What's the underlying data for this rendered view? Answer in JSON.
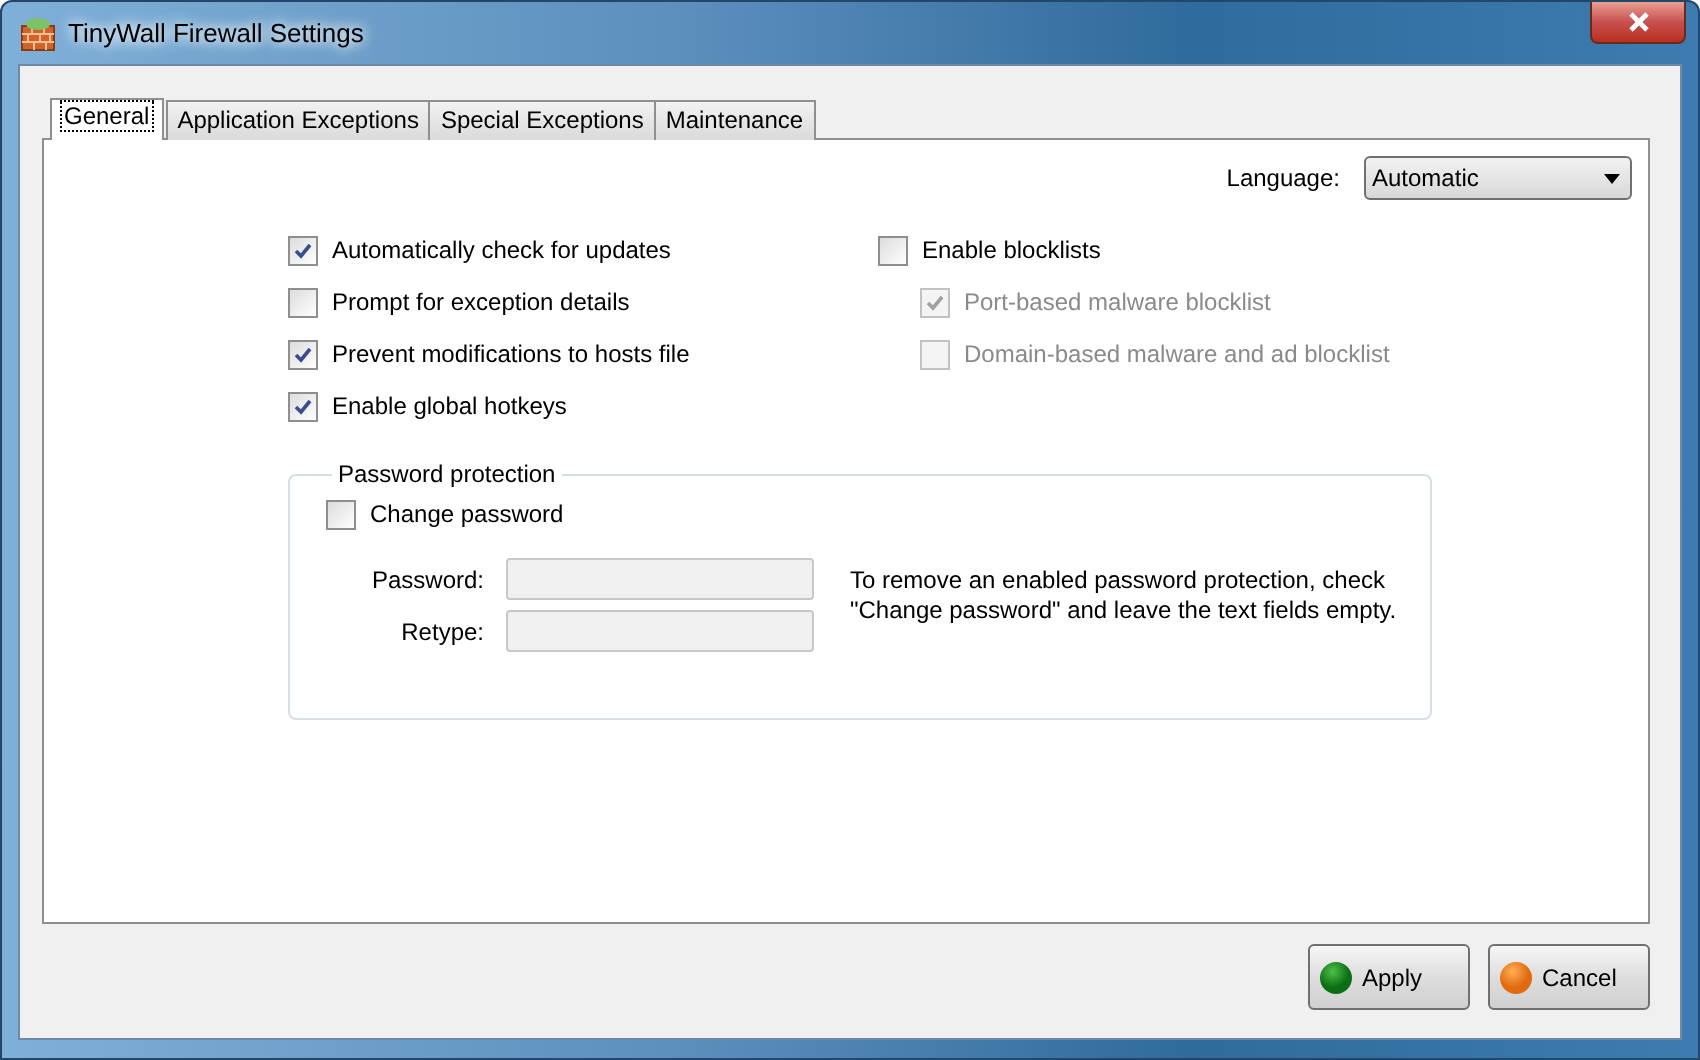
{
  "window": {
    "title": "TinyWall Firewall Settings"
  },
  "tabs": [
    {
      "label": "General",
      "selected": true
    },
    {
      "label": "Application Exceptions",
      "selected": false
    },
    {
      "label": "Special Exceptions",
      "selected": false
    },
    {
      "label": "Maintenance",
      "selected": false
    }
  ],
  "language": {
    "label": "Language:",
    "value": "Automatic"
  },
  "options": [
    {
      "label": "Automatically check for updates",
      "checked": true
    },
    {
      "label": "Prompt for exception details",
      "checked": false
    },
    {
      "label": "Prevent modifications to hosts file",
      "checked": true
    },
    {
      "label": "Enable global hotkeys",
      "checked": true
    }
  ],
  "blocklists": {
    "label": "Enable blocklists",
    "checked": false,
    "children": [
      {
        "label": "Port-based malware blocklist",
        "checked": true,
        "disabled": true
      },
      {
        "label": "Domain-based malware and ad blocklist",
        "checked": false,
        "disabled": true
      }
    ]
  },
  "password_protection": {
    "title": "Password protection",
    "change_password": {
      "label": "Change password",
      "checked": false
    },
    "fields": [
      {
        "label": "Password:",
        "disabled": true
      },
      {
        "label": "Retype:",
        "disabled": true
      }
    ],
    "note": "To remove an enabled password protection, check \"Change password\" and leave the text fields empty."
  },
  "buttons": [
    {
      "label": "Apply",
      "kind": "apply"
    },
    {
      "label": "Cancel",
      "kind": "cancel"
    }
  ]
}
